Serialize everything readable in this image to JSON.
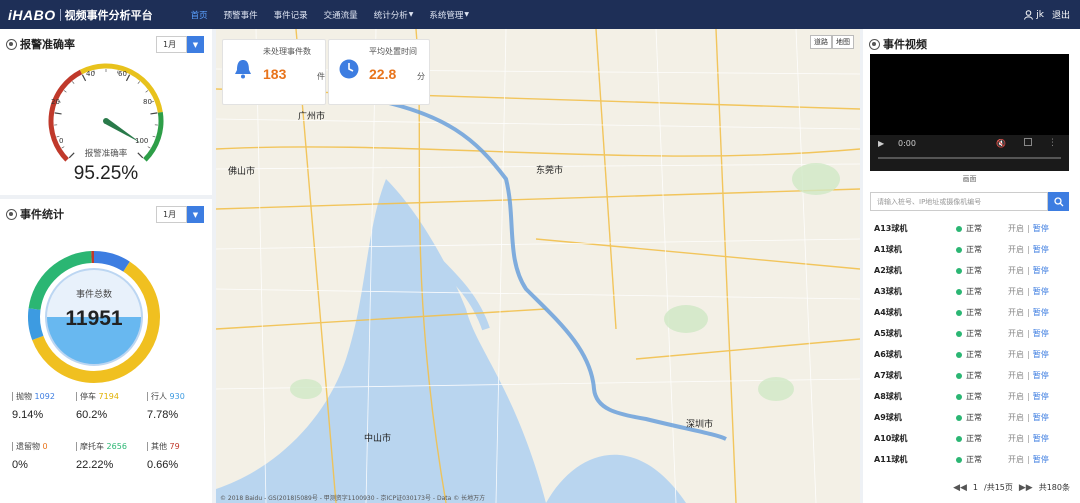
{
  "header": {
    "logo": "iHABO",
    "title": "视频事件分析平台",
    "nav": [
      {
        "label": "首页",
        "active": true
      },
      {
        "label": "预警事件"
      },
      {
        "label": "事件记录"
      },
      {
        "label": "交通流量"
      },
      {
        "label": "统计分析",
        "dropdown": true
      },
      {
        "label": "系统管理",
        "dropdown": true
      }
    ],
    "user": "jk",
    "logout": "退出"
  },
  "alarm_panel": {
    "title": "报警准确率",
    "month": "1月",
    "gauge": {
      "min": 0,
      "max": 100,
      "ticks": [
        "0",
        "20",
        "40",
        "60",
        "80",
        "100"
      ],
      "value": 95.25,
      "caption": "报警准确率",
      "display": "95.25%"
    }
  },
  "event_panel": {
    "title": "事件统计",
    "month": "1月",
    "donut_label": "事件总数",
    "total": "11951",
    "stats": [
      {
        "label": "抛物",
        "count": "1092",
        "pct": "9.14%",
        "color": "#3d7de1"
      },
      {
        "label": "停车",
        "count": "7194",
        "pct": "60.2%",
        "color": "#f0c020"
      },
      {
        "label": "行人",
        "count": "930",
        "pct": "7.78%",
        "color": "#3d9be1"
      },
      {
        "label": "遗留物",
        "count": "0",
        "pct": "0%",
        "color": "#e8741c"
      },
      {
        "label": "摩托车",
        "count": "2656",
        "pct": "22.22%",
        "color": "#2bb673"
      },
      {
        "label": "其他",
        "count": "79",
        "pct": "0.66%",
        "color": "#c0392b"
      }
    ]
  },
  "chart_data": {
    "type": "pie",
    "title": "事件总数",
    "categories": [
      "抛物",
      "停车",
      "行人",
      "遗留物",
      "摩托车",
      "其他"
    ],
    "values": [
      1092,
      7194,
      930,
      0,
      2656,
      79
    ],
    "colors": [
      "#3d7de1",
      "#f0c020",
      "#3d9be1",
      "#e8741c",
      "#2bb673",
      "#c0392b"
    ],
    "total": 11951
  },
  "map": {
    "kpi_unhandled": {
      "title": "未处理事件数",
      "value": "183",
      "unit": "件"
    },
    "kpi_time": {
      "title": "平均处置时间",
      "value": "22.8",
      "unit": "分"
    },
    "btn_road": "道路",
    "btn_sat": "地图",
    "city_labels": [
      "广州市",
      "佛山市",
      "东莞市",
      "深圳市",
      "中山市"
    ],
    "copyright": "© 2018 Baidu - GS(2018)5089号 - 甲测资字1100930 - 京ICP证030173号 - Data © 长地万方"
  },
  "video_panel": {
    "title": "事件视频",
    "time": "0:00",
    "caption": "画面",
    "search_placeholder": "请输入桩号、IP地址或摄像机编号",
    "cameras": [
      {
        "name": "A13球机",
        "status": "正常",
        "on": "开启",
        "off": "暂停"
      },
      {
        "name": "A1球机",
        "status": "正常",
        "on": "开启",
        "off": "暂停"
      },
      {
        "name": "A2球机",
        "status": "正常",
        "on": "开启",
        "off": "暂停"
      },
      {
        "name": "A3球机",
        "status": "正常",
        "on": "开启",
        "off": "暂停"
      },
      {
        "name": "A4球机",
        "status": "正常",
        "on": "开启",
        "off": "暂停"
      },
      {
        "name": "A5球机",
        "status": "正常",
        "on": "开启",
        "off": "暂停"
      },
      {
        "name": "A6球机",
        "status": "正常",
        "on": "开启",
        "off": "暂停"
      },
      {
        "name": "A7球机",
        "status": "正常",
        "on": "开启",
        "off": "暂停"
      },
      {
        "name": "A8球机",
        "status": "正常",
        "on": "开启",
        "off": "暂停"
      },
      {
        "name": "A9球机",
        "status": "正常",
        "on": "开启",
        "off": "暂停"
      },
      {
        "name": "A10球机",
        "status": "正常",
        "on": "开启",
        "off": "暂停"
      },
      {
        "name": "A11球机",
        "status": "正常",
        "on": "开启",
        "off": "暂停"
      }
    ],
    "pager": {
      "page": "1",
      "pages": "/共15页",
      "total": "共180条"
    }
  }
}
